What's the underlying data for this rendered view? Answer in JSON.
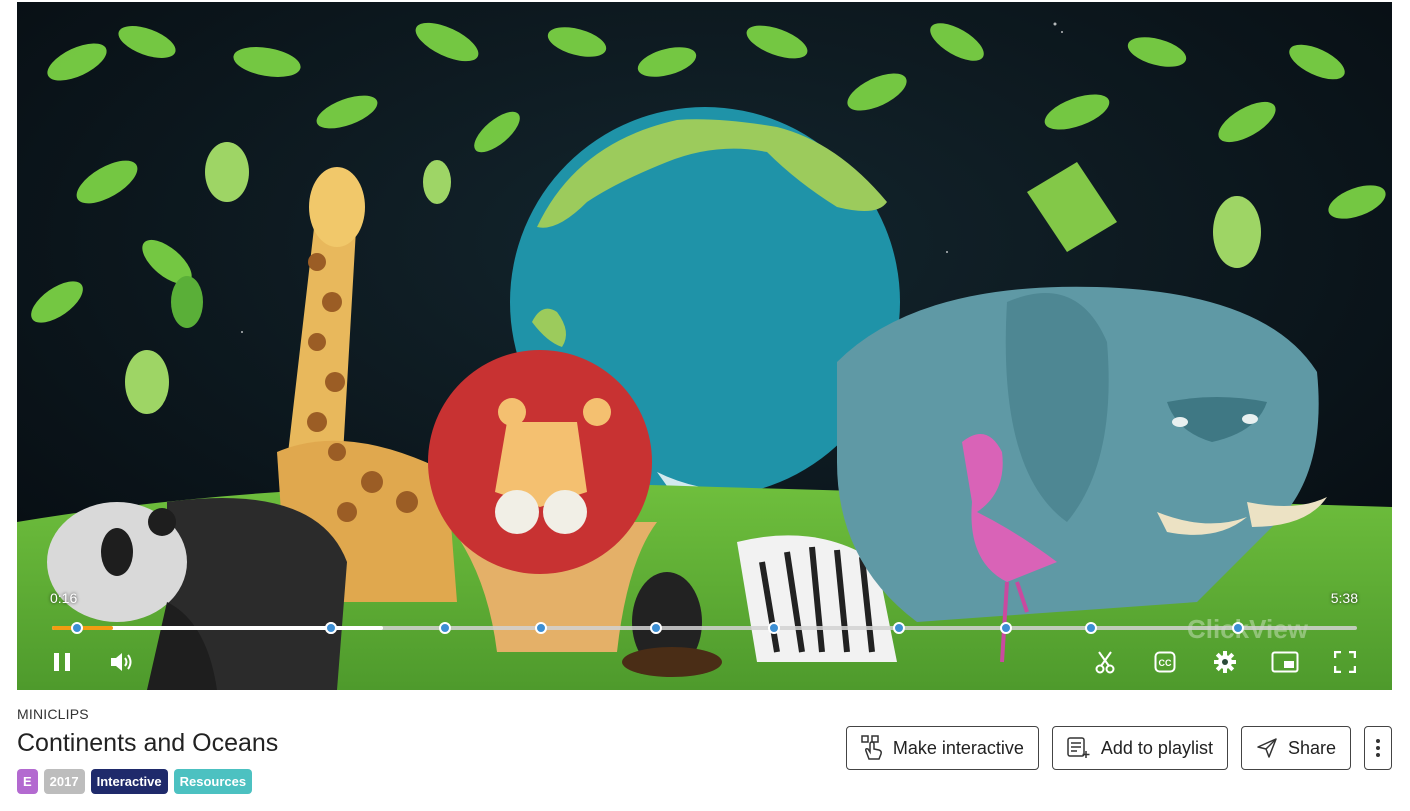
{
  "video": {
    "current_time": "0:16",
    "total_time": "5:38",
    "progress": 0.047,
    "buffered": 0.254,
    "scrub_position": 0.214,
    "chapter_markers": [
      0.019,
      0.214,
      0.301,
      0.375,
      0.463,
      0.553,
      0.649,
      0.731,
      0.796,
      0.909
    ],
    "watermark": "ClickView",
    "controls": {
      "pause": "pause-icon",
      "volume": "volume-icon",
      "clip": "scissors-icon",
      "captions": "cc-icon",
      "settings": "gear-icon",
      "picture_in_picture": "pip-icon",
      "fullscreen": "fullscreen-icon"
    },
    "colors": {
      "progress": "#f39c12",
      "marker": "#3d8fd4"
    }
  },
  "details": {
    "provider": "MINICLIPS",
    "title": "Continents and Oceans",
    "tags": [
      {
        "label": "E",
        "color": "#b36ad0"
      },
      {
        "label": "2017",
        "color": "#bdbdbd"
      },
      {
        "label": "Interactive",
        "color": "#1f2a6b"
      },
      {
        "label": "Resources",
        "color": "#4cc1c1"
      }
    ]
  },
  "actions": {
    "make_interactive": "Make interactive",
    "add_to_playlist": "Add to playlist",
    "share": "Share"
  }
}
